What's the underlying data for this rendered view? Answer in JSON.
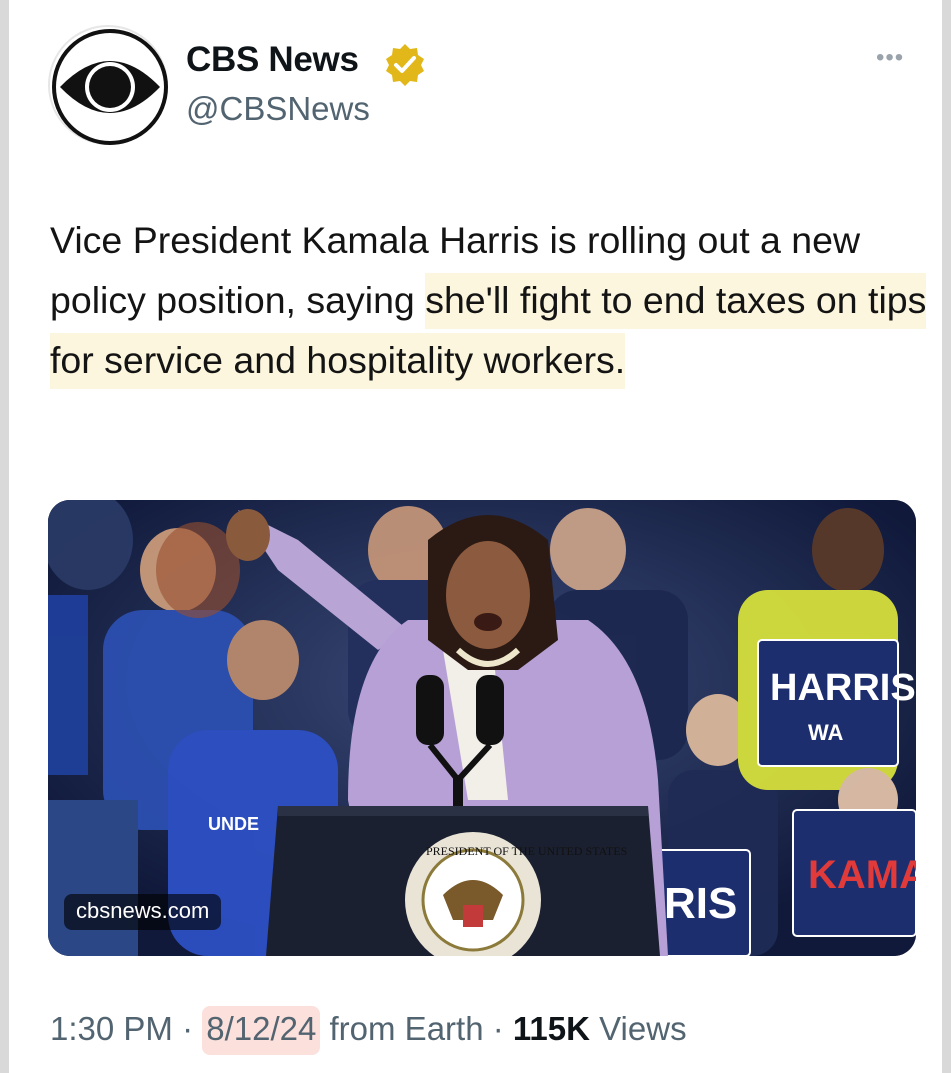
{
  "account": {
    "display_name": "CBS News",
    "handle": "@CBSNews",
    "verified_icon": "gold-verified-badge-icon",
    "avatar_icon": "cbs-eye-logo-icon"
  },
  "tweet": {
    "text_plain": "Vice President Kamala Harris is rolling out a new policy position, saying ",
    "text_highlight": "she'll fight to end taxes on tips for service and hospitality workers."
  },
  "media": {
    "source": "cbsnews.com",
    "signs": [
      "HARRIS",
      "WA",
      "KAMA",
      "RIS",
      "UNDE"
    ],
    "seal_text": "PRESIDENT OF THE UNITED STATES"
  },
  "meta": {
    "time": "1:30 PM",
    "sep1": " · ",
    "date": "8/12/24",
    "from": " from Earth",
    "sep2": " · ",
    "views_count": "115K",
    "views_label": " Views"
  },
  "colors": {
    "highlight": "#fbf6dd",
    "date_highlight": "#fbe0dc",
    "verified_gold": "#e2b719",
    "secondary_text": "#536471"
  }
}
